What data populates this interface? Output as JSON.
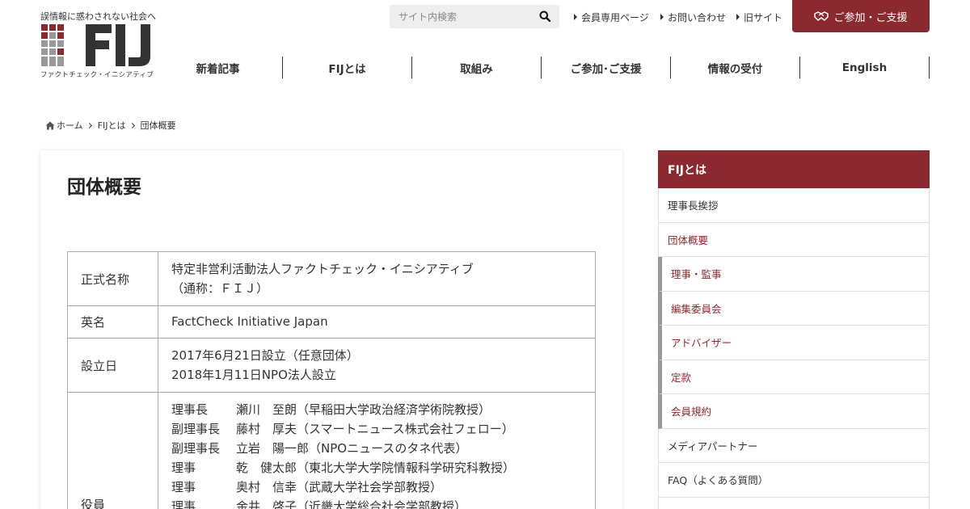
{
  "header": {
    "tagline": "誤情報に惑わされない社会へ",
    "logo_text": "FIJ",
    "logo_sub": "ファクトチェック・イニシアティブ",
    "search_placeholder": "サイト内検索",
    "top_links": [
      "会員専用ページ",
      "お問い合わせ",
      "旧サイト"
    ],
    "join_button": "ご参加・ご支援",
    "brand_color": "#8b2a2e"
  },
  "gnav": [
    "新着記事",
    "FIJとは",
    "取組み",
    "ご参加･ご支援",
    "情報の受付",
    "English"
  ],
  "breadcrumb": [
    "ホーム",
    "FIJとは",
    "団体概要"
  ],
  "main": {
    "title": "団体概要",
    "rows": {
      "name": {
        "label": "正式名称",
        "lines": [
          "特定非営利活動法人ファクトチェック・イニシアティブ",
          "（通称：ＦＩＪ）"
        ]
      },
      "english": {
        "label": "英名",
        "value": "FactCheck Initiative Japan"
      },
      "founded": {
        "label": "設立日",
        "lines": [
          "2017年6月21日設立（任意団体）",
          "2018年1月11日NPO法人設立"
        ]
      },
      "officers": {
        "label": "役員",
        "list": [
          {
            "role": "理事長",
            "name": "瀬川　至朗（早稲田大学政治経済学術院教授）"
          },
          {
            "role": "副理事長",
            "name": "藤村　厚夫（スマートニュース株式会社フェロー）"
          },
          {
            "role": "副理事長",
            "name": "立岩　陽一郎（NPOニュースのタネ代表）"
          },
          {
            "role": "理事",
            "name": "乾　健太郎（東北大学大学院情報科学研究科教授）"
          },
          {
            "role": "理事",
            "name": "奥村　信幸（武蔵大学社会学部教授）"
          },
          {
            "role": "理事",
            "name": "金井　啓子（近畿大学総合社会学部教授）"
          }
        ]
      }
    }
  },
  "sidebar": {
    "heading": "FIJとは",
    "items": [
      {
        "label": "理事長挨拶",
        "type": "normal"
      },
      {
        "label": "団体概要",
        "type": "active"
      },
      {
        "label": "理事・監事",
        "type": "sub"
      },
      {
        "label": "編集委員会",
        "type": "sub"
      },
      {
        "label": "アドバイザー",
        "type": "sub"
      },
      {
        "label": "定款",
        "type": "sub"
      },
      {
        "label": "会員規約",
        "type": "sub"
      },
      {
        "label": "メディアパートナー",
        "type": "normal"
      },
      {
        "label": "FAQ（よくある質問）",
        "type": "normal"
      },
      {
        "label": "",
        "type": "normal"
      }
    ]
  }
}
